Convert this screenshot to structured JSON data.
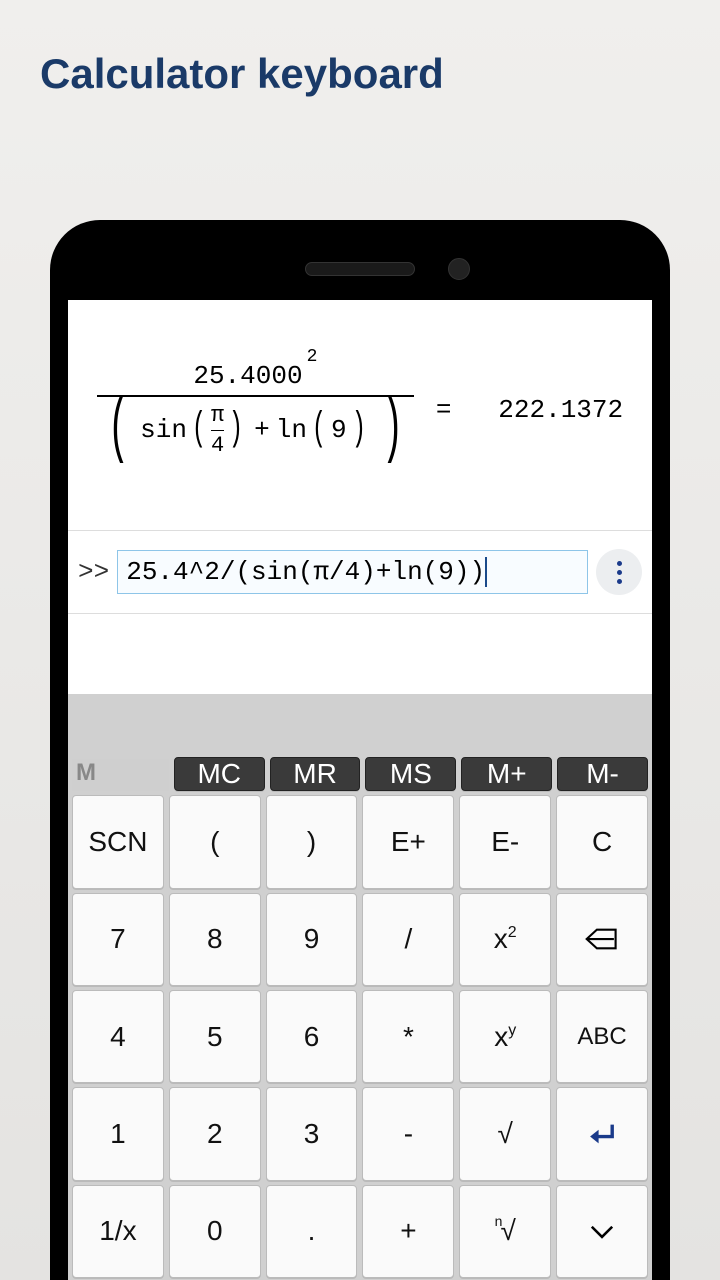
{
  "heading": "Calculator keyboard",
  "formula": {
    "base": "25.4000",
    "exponent": "2",
    "sin_label": "sin",
    "pi": "π",
    "four": "4",
    "plus": "+",
    "ln_label": "ln",
    "ln_arg": "9",
    "equals": "=",
    "result": "222.1372"
  },
  "input": {
    "prompt": ">>",
    "expression": "25.4^2/(sin(π/4)+ln(9))"
  },
  "memory_label": "M",
  "keys": {
    "mem": [
      "MC",
      "MR",
      "MS",
      "M+",
      "M-"
    ],
    "r1": [
      "SCN",
      "(",
      ")",
      "E+",
      "E-",
      "C"
    ],
    "r2": [
      "7",
      "8",
      "9",
      "/",
      "x²",
      "⇐"
    ],
    "r3": [
      "4",
      "5",
      "6",
      "*",
      "xʸ",
      "ABC"
    ],
    "r4": [
      "1",
      "2",
      "3",
      "-",
      "√",
      "↵"
    ],
    "r5": [
      "1/x",
      "0",
      ".",
      "+",
      "ⁿ√",
      "⌄"
    ]
  }
}
